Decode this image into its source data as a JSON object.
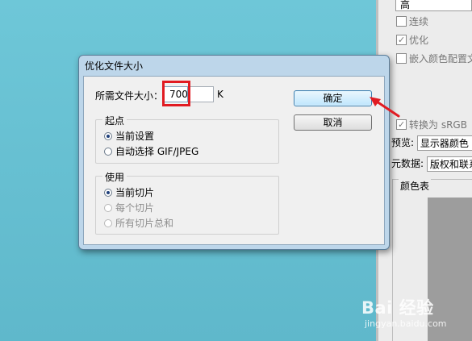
{
  "dialog": {
    "title": "优化文件大小",
    "size_label": "所需文件大小：",
    "size_value": "700",
    "size_unit": "K",
    "start_group": {
      "legend": "起点",
      "options": [
        "当前设置",
        "自动选择 GIF/JPEG"
      ],
      "selected": 0
    },
    "use_group": {
      "legend": "使用",
      "options": [
        "当前切片",
        "每个切片",
        "所有切片总和"
      ],
      "selected": 0
    },
    "ok_label": "确定",
    "cancel_label": "取消"
  },
  "right_panel": {
    "quality_value": "高",
    "continuous_label": "连续",
    "optimize_label": "优化",
    "embed_profile_label": "嵌入颜色配置文",
    "convert_srgb_label": "转换为 sRGB",
    "preview_label": "预览:",
    "preview_value": "显示器颜色",
    "metadata_label": "元数据:",
    "metadata_value": "版权和联系",
    "color_table_label": "颜色表"
  },
  "watermark": {
    "brand": "Bai  经验",
    "url": "jingyan.baidu.com"
  },
  "colors": {
    "highlight": "#e11b22",
    "desktop": "#6ec7d8"
  }
}
